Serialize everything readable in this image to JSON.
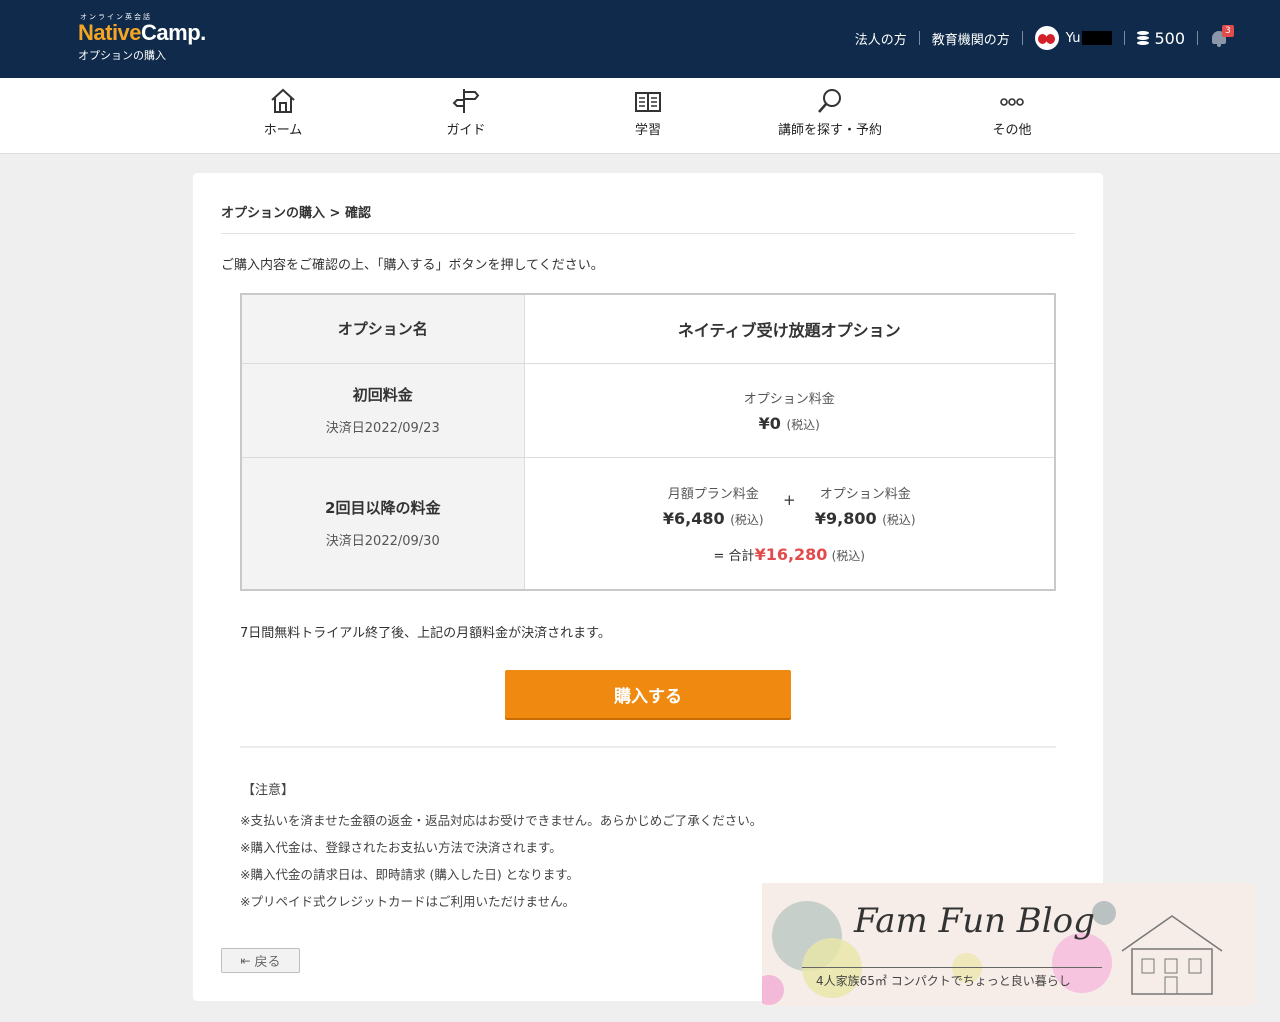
{
  "header": {
    "logo_small": "オンライン英会話",
    "logo_part1": "Native",
    "logo_part2": "Camp.",
    "page_subtitle": "オプションの購入",
    "corporate_link": "法人の方",
    "education_link": "教育機関の方",
    "user_name": "Yu",
    "coins": "500",
    "notifications": "3"
  },
  "nav": {
    "items": [
      {
        "label": "ホーム",
        "icon": "home-icon"
      },
      {
        "label": "ガイド",
        "icon": "signpost-icon"
      },
      {
        "label": "学習",
        "icon": "book-icon"
      },
      {
        "label": "講師を探す・予約",
        "icon": "search-icon"
      },
      {
        "label": "その他",
        "icon": "more-icon"
      }
    ]
  },
  "main": {
    "breadcrumb": "オプションの購入 > 確認",
    "intro": "ご購入内容をご確認の上、「購入する」ボタンを押してください。",
    "table": {
      "option_name_label": "オプション名",
      "option_name_value": "ネイティブ受け放題オプション",
      "first_fee_label": "初回料金",
      "first_fee_date": "決済日2022/09/23",
      "first_fee_item": "オプション料金",
      "first_fee_price": "¥0",
      "tax_label": "(税込)",
      "second_fee_label": "2回目以降の料金",
      "second_fee_date": "決済日2022/09/30",
      "monthly_plan_label": "月額プラン料金",
      "monthly_plan_price": "¥6,480",
      "plus": "+",
      "option_fee_label": "オプション料金",
      "option_fee_price": "¥9,800",
      "total_prefix": "= 合計",
      "total_amount": "¥16,280"
    },
    "trial_note": "7日間無料トライアル終了後、上記の月額料金が決済されます。",
    "buy_button": "購入する",
    "caution_title": "【注意】",
    "notes": [
      "※支払いを済ませた金額の返金・返品対応はお受けできません。あらかじめご了承ください。",
      "※購入代金は、登録されたお支払い方法で決済されます。",
      "※購入代金の請求日は、即時請求 (購入した日) となります。",
      "※プリペイド式クレジットカードはご利用いただけません。"
    ],
    "back_button": "戻る"
  },
  "watermark": {
    "title": "Fam Fun Blog",
    "tagline": "4人家族65㎡ コンパクトでちょっと良い暮らし"
  },
  "colors": {
    "header_bg": "#0f2a4a",
    "accent_orange": "#f0890f",
    "total_red": "#e24b4b"
  }
}
